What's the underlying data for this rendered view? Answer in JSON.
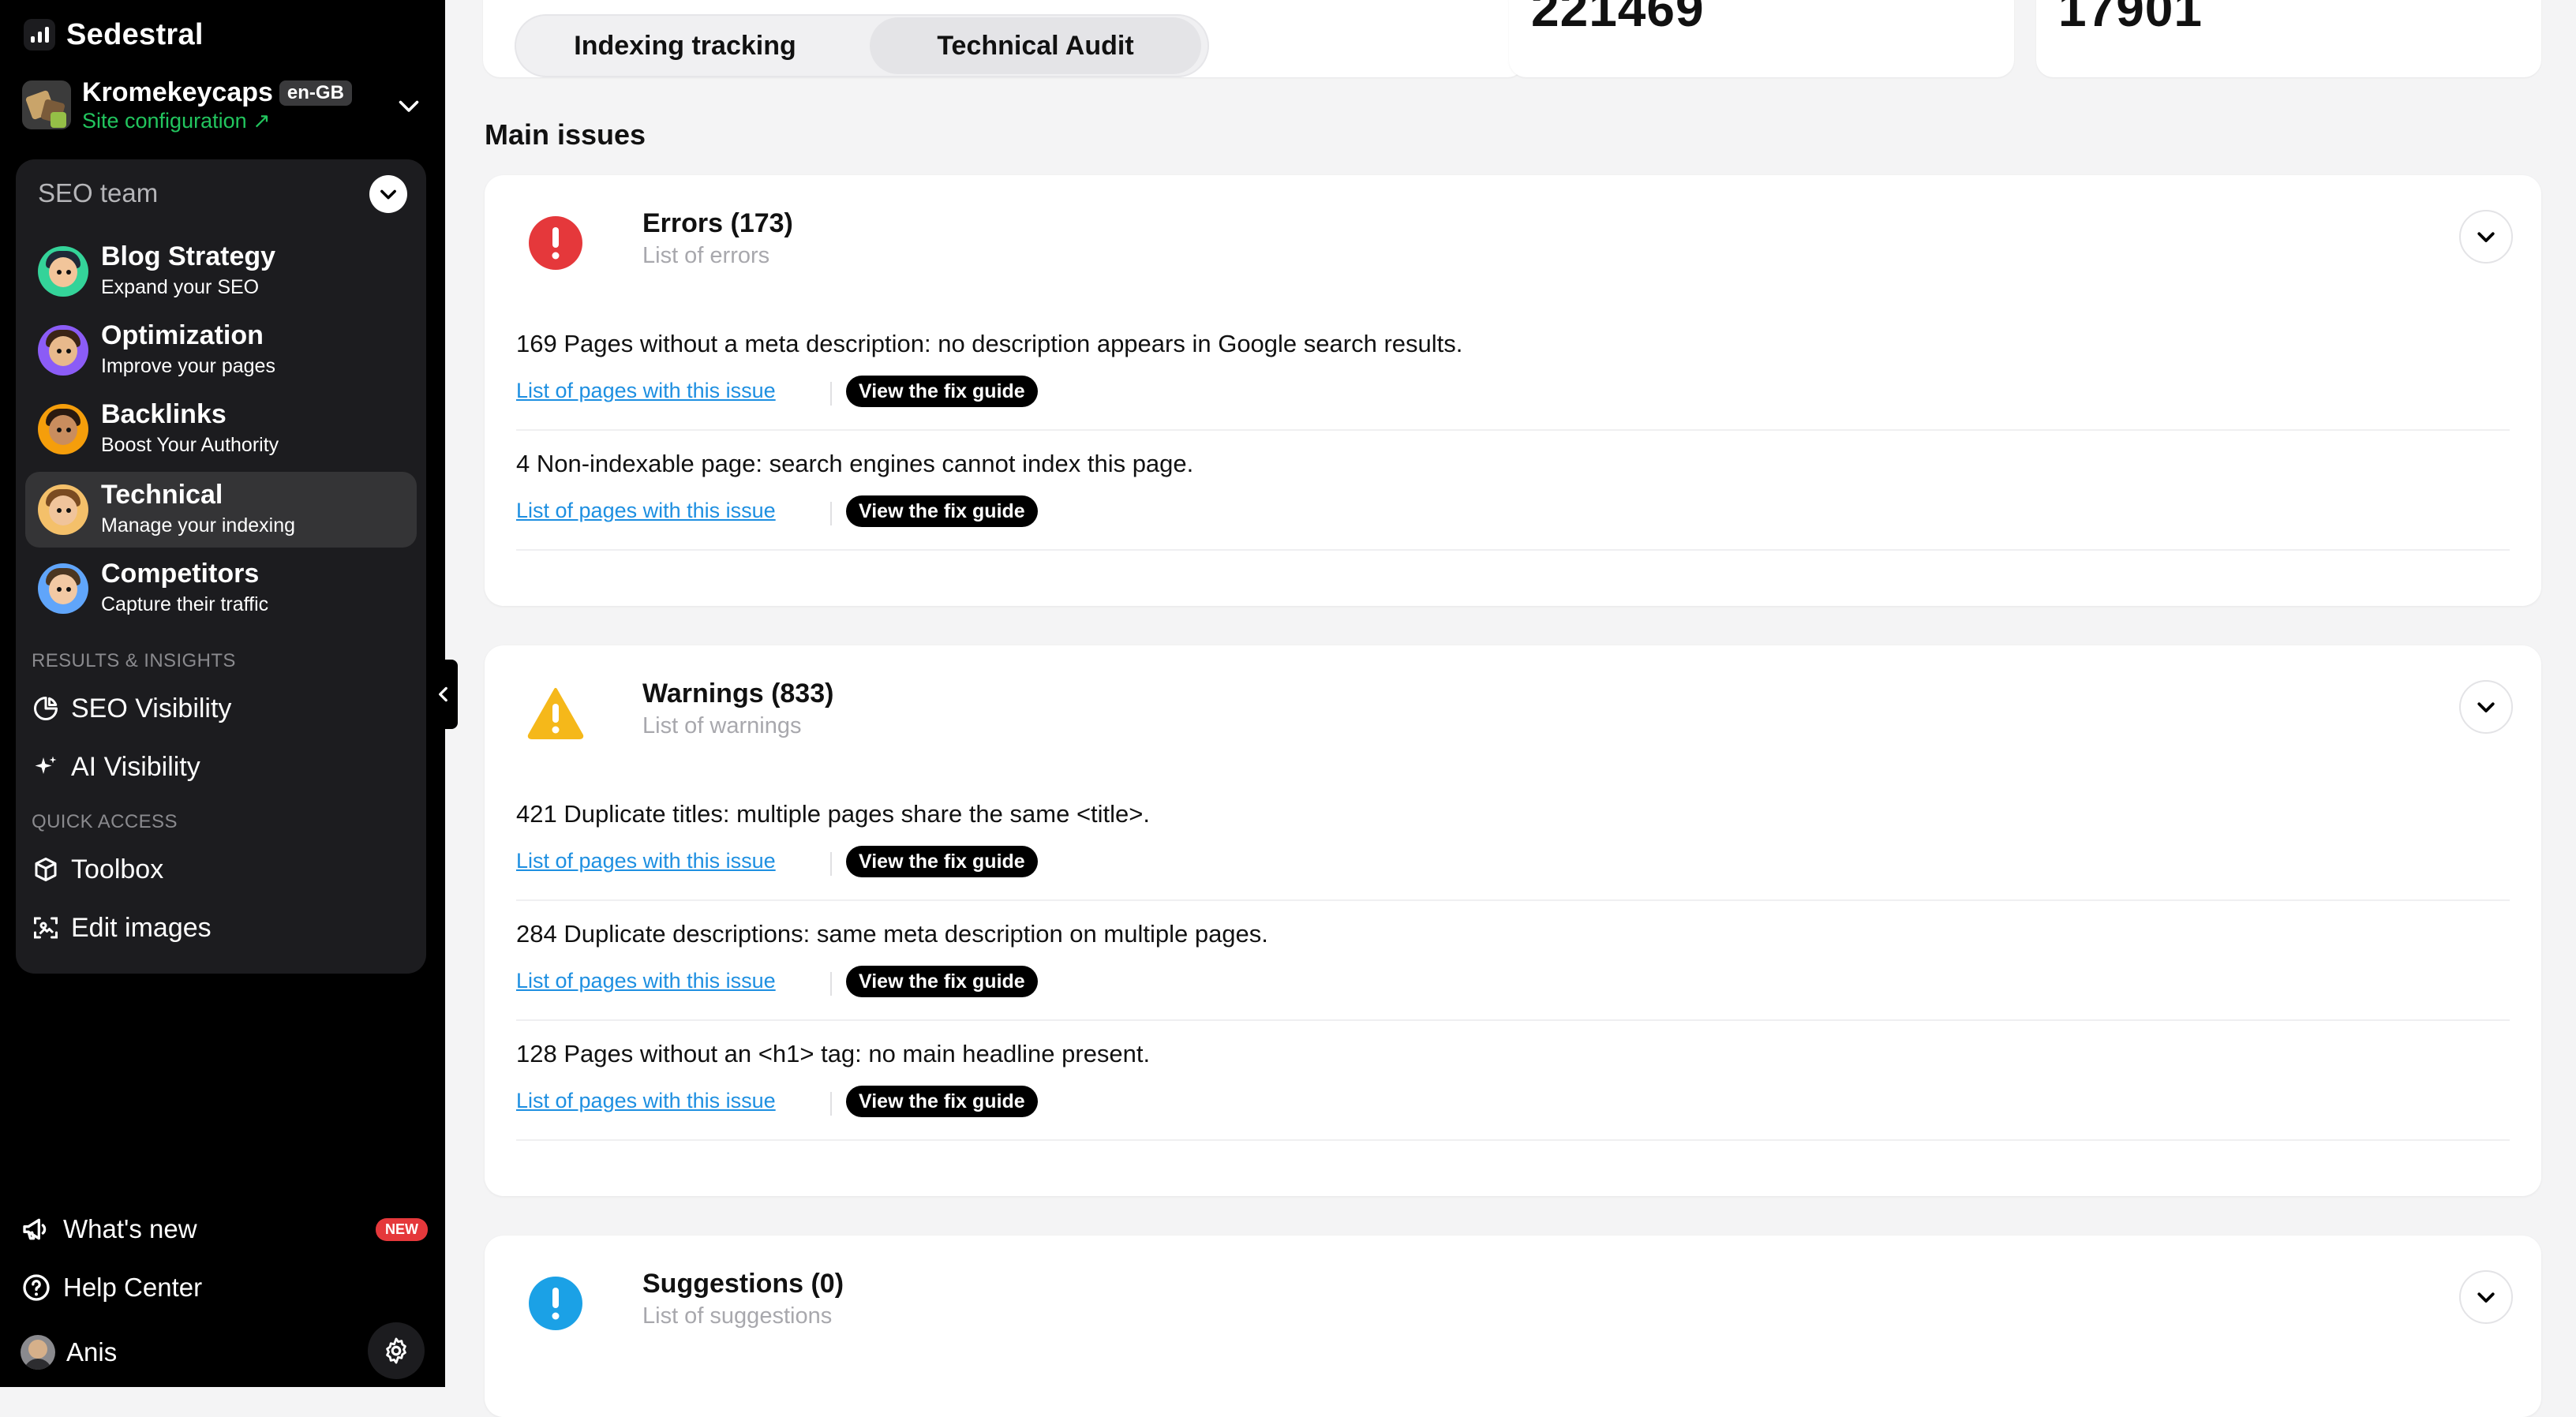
{
  "brand": {
    "name": "Sedestral"
  },
  "site": {
    "name": "Kromekeycaps",
    "lang": "en-GB",
    "config_label": "Site configuration ↗"
  },
  "team": {
    "header": "SEO team",
    "agents": [
      {
        "title": "Blog Strategy",
        "sub": "Expand your SEO"
      },
      {
        "title": "Optimization",
        "sub": "Improve your pages"
      },
      {
        "title": "Backlinks",
        "sub": "Boost Your Authority"
      },
      {
        "title": "Technical",
        "sub": "Manage your indexing"
      },
      {
        "title": "Competitors",
        "sub": "Capture their traffic"
      }
    ],
    "results_label": "RESULTS & INSIGHTS",
    "results": [
      {
        "label": "SEO Visibility"
      },
      {
        "label": "AI Visibility"
      }
    ],
    "quick_label": "QUICK ACCESS",
    "quick": [
      {
        "label": "Toolbox"
      },
      {
        "label": "Edit images"
      }
    ]
  },
  "bottom": {
    "whats_new": "What's new",
    "new_badge": "NEW",
    "help": "Help Center",
    "user": "Anis"
  },
  "tabs": [
    {
      "label": "Indexing tracking"
    },
    {
      "label": "Technical Audit"
    }
  ],
  "stats": {
    "value1": "221469",
    "value2": "17901"
  },
  "main_title": "Main issues",
  "link_label": "List of pages with this issue",
  "fix_label": "View the fix guide",
  "sections": [
    {
      "title": "Errors (173)",
      "sub": "List of errors",
      "color": "#e5383b",
      "issues": [
        {
          "text": "169 Pages without a meta description: no description appears in Google search results."
        },
        {
          "text": "4 Non-indexable page: search engines cannot index this page."
        }
      ]
    },
    {
      "title": "Warnings (833)",
      "sub": "List of warnings",
      "color": "#f5b81a",
      "issues": [
        {
          "text": "421 Duplicate titles: multiple pages share the same <title>."
        },
        {
          "text": "284 Duplicate descriptions: same meta description on multiple pages."
        },
        {
          "text": "128 Pages without an <h1> tag: no main headline present."
        }
      ]
    },
    {
      "title": "Suggestions (0)",
      "sub": "List of suggestions",
      "color": "#1ba1e6",
      "issues": []
    }
  ]
}
